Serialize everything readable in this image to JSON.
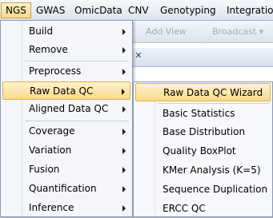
{
  "menubar": {
    "items": [
      {
        "label": "NGS",
        "active": true
      },
      {
        "label": "GWAS"
      },
      {
        "label": "OmicData"
      },
      {
        "label": "CNV"
      },
      {
        "label": "Genotyping"
      },
      {
        "label": "Integration"
      }
    ]
  },
  "background": {
    "toolbar": {
      "add_view": "Add View",
      "broadcast": "Broadcast"
    }
  },
  "ngs_menu": {
    "items": [
      {
        "label": "Build"
      },
      {
        "label": "Remove"
      },
      {
        "label": "Preprocess"
      },
      {
        "label": "Raw Data QC"
      },
      {
        "label": "Aligned Data QC"
      },
      {
        "label": "Coverage"
      },
      {
        "label": "Variation"
      },
      {
        "label": "Fusion"
      },
      {
        "label": "Quantification"
      },
      {
        "label": "Inference"
      }
    ],
    "highlighted": "Raw Data QC"
  },
  "raw_data_qc_submenu": {
    "items": [
      {
        "label": "Raw Data QC Wizard"
      },
      {
        "label": "Basic Statistics"
      },
      {
        "label": "Base Distribution"
      },
      {
        "label": "Quality BoxPlot"
      },
      {
        "label": "KMer Analysis (K=5)"
      },
      {
        "label": "Sequence Duplication"
      },
      {
        "label": "ERCC QC"
      }
    ],
    "highlighted": "Raw Data QC Wizard"
  },
  "colors": {
    "highlight_top": "#fef3cd",
    "highlight_bottom": "#fbd98a",
    "menu_bg": "#f4f6fa",
    "menu_border": "#8a9bb5"
  }
}
